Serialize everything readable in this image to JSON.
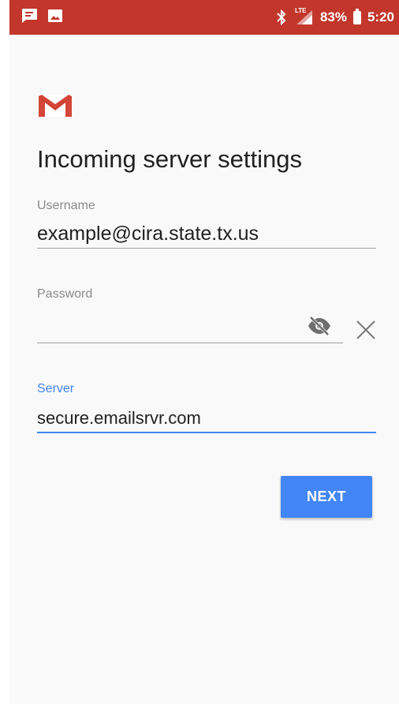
{
  "status_bar": {
    "battery": "83%",
    "time": "5:20",
    "network": "LTE",
    "icons": [
      "message-icon",
      "image-icon",
      "bluetooth-icon",
      "signal-icon",
      "battery-icon"
    ]
  },
  "app": {
    "logo_icon": "gmail-logo-icon",
    "title": "Incoming server settings"
  },
  "form": {
    "username": {
      "label": "Username",
      "value": "example@cira.state.tx.us"
    },
    "password": {
      "label": "Password",
      "value": ""
    },
    "server": {
      "label": "Server",
      "value": "secure.emailsrvr.com"
    }
  },
  "actions": {
    "next_label": "NEXT"
  },
  "colors": {
    "status_bar": "#c2362b",
    "accent": "#4285f4",
    "gmail_red": "#d44638"
  }
}
